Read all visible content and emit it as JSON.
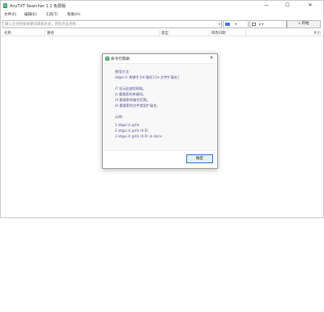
{
  "window": {
    "title": "AnyTXT Searcher 1.2 免费版",
    "minimize_glyph": "—",
    "maximize_glyph": "☐",
    "close_glyph": "✕"
  },
  "menu": [
    "文件(F)",
    "编辑(E)",
    "工具(T)",
    "帮助(H)"
  ],
  "search": {
    "placeholder": "输入全文检索关键词或表达式，然后点击开始…",
    "dropdown_arrow": "▾",
    "file_type_arrow": "▾",
    "path_arrow": "▸ ▾",
    "button_label": "⌕ 开始"
  },
  "columns": [
    "名称",
    "路径",
    "类型",
    "修改日期",
    "大小"
  ],
  "dialog": {
    "title": "命令行帮助",
    "close_glyph": "✕",
    "lines": [
      "使用方法:",
      "atgui /s 关键字 [/d 路径] [/e 文件扩展名]",
      "/? 显示此使用帮助。",
      "/s 要搜索的关键词。",
      "/d 要搜索的路径范围。",
      "/e 要搜索的文件类型扩展名。",
      "示例:",
      "1 atgui /s girls",
      "2 atgui /s girls /d D:",
      "3 atgui /s girls /d D: /e docx"
    ],
    "ok_label": "确定"
  },
  "colors": {
    "accent": "#1e73d9",
    "dialog_text": "#4a4a8a",
    "app_icon": "#2f9a5a"
  },
  "icons": {
    "app": "app-logo-icon",
    "dialog": "app-logo-icon",
    "search": "magnifier-icon"
  }
}
